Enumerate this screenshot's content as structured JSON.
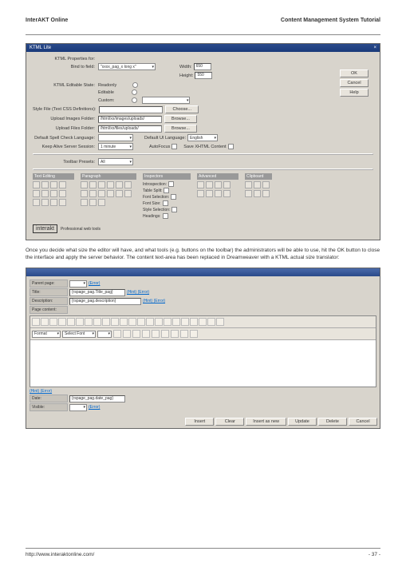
{
  "header": {
    "left": "InterAKT Online",
    "right": "Content Management System Tutorial"
  },
  "dialog": {
    "title": "KTML Lite",
    "buttons": {
      "ok": "OK",
      "cancel": "Cancel",
      "help": "Help"
    },
    "propsLabel": "KTML Properties for:",
    "bindLabel": "Bind to field:",
    "bindValue": "\"xxxx_pag_x long x\"",
    "widthLabel": "Width:",
    "widthValue": "650",
    "heightLabel": "Height:",
    "heightValue": "550",
    "editState": "KTML Editable State:",
    "readonly": "Readonly",
    "editable": "Editable",
    "custom": "Custom:",
    "styleLabel": "Style File (Text CSS Definitions):",
    "styleBtn": "Choose...",
    "upImgLabel": "Upload Images Folder:",
    "upImgVal": "/html/xx/images/uploads/",
    "browse": "Browse...",
    "upFileLabel": "Upload Files Folder:",
    "upFileVal": "/html/xx/files/uploads/",
    "spellLabel": "Default Spell Check Language:",
    "uiLabel": "Default UI Language:",
    "uiVal": "English",
    "keepLabel": "Keep Alive Server Session:",
    "keepVal": "1 minute",
    "autoFocus": "AutoFocus",
    "saveContent": "Save XHTML Content",
    "presetsLabel": "Toolbar Presets:",
    "presetsVal": "All",
    "cols": {
      "c1": "Text Editing",
      "c2": "Paragraph",
      "c3": "Inspectors",
      "c4": "Advanced",
      "c5": "Clipboard"
    },
    "insp": {
      "a": "Introspection:",
      "b": "Table Split:",
      "c": "Font Selection:",
      "d": "Font Size:",
      "e": "Style Selection:",
      "f": "Headings:"
    },
    "logoText": "interakt",
    "logoTag": "Professional web tools"
  },
  "para": "Once you decide what size the editor will have, and what tools (e.g. buttons on the toolbar) the administrators will be able to use, hit the OK button to close the interface and apply the server behavior. The content text-area has been replaced in Dreamweaver with a KTML actual size translator:",
  "form2": {
    "parent": "Parent page:",
    "title": "Title:",
    "desc": "Description:",
    "content": "Page content:",
    "date": "Date:",
    "visible": "Visible:",
    "titleVal": "{rspage_pag.Title_pag}",
    "descVal": "{rspage_pag.description}",
    "hint": "(Hint) (Error)",
    "error": "(Error)",
    "dateVal": "{rspage_pag.date_pag}",
    "format": "Format",
    "font": "Select Font",
    "btns": {
      "ins": "Insert",
      "clear": "Clear",
      "insnew": "Insert as new",
      "update": "Update",
      "del": "Delete",
      "cancel": "Cancel"
    }
  },
  "footer": {
    "url": "http://www.interaktonline.com/",
    "page": "- 37 -"
  }
}
